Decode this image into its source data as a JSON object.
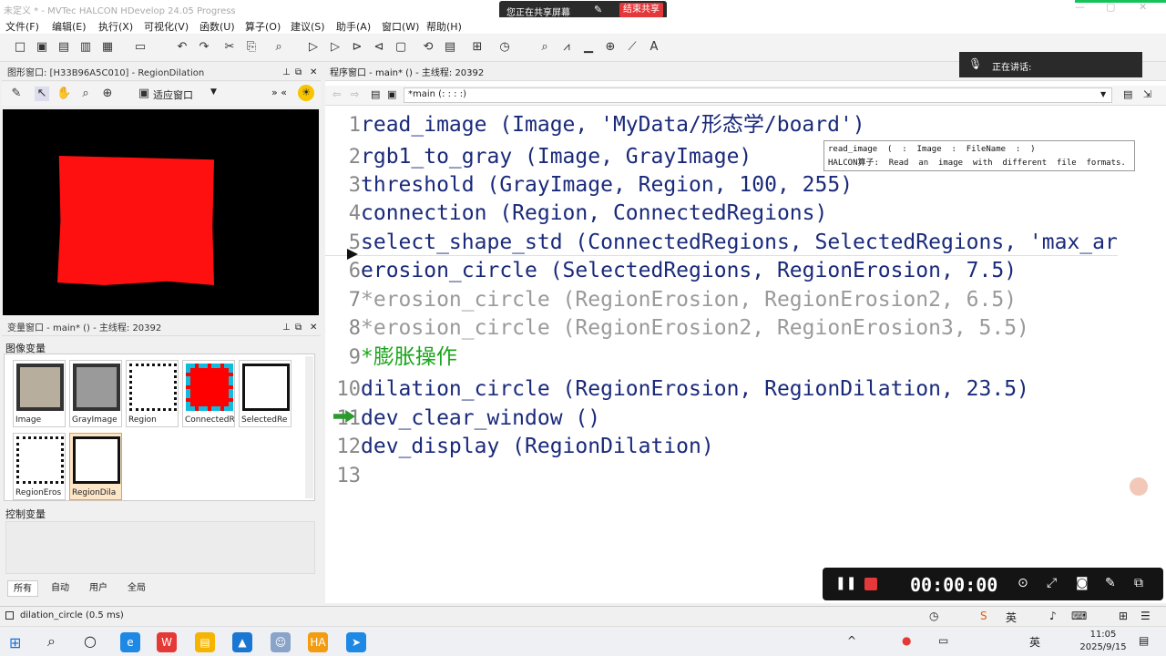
{
  "window": {
    "title": "未定义 * - MVTec HALCON HDevelop 24.05 Progress"
  },
  "share": {
    "status": "您正在共享屏幕",
    "end_label": "结束共享"
  },
  "menu": [
    "文件(F)",
    "编辑(E)",
    "执行(X)",
    "可视化(V)",
    "函数(U)",
    "算子(O)",
    "建议(S)",
    "助手(A)",
    "窗口(W)",
    "帮助(H)"
  ],
  "graphics": {
    "title": "图形窗口: [H33B96A5C010] - RegionDilation",
    "fit_label": "适应窗口",
    "region_color": "#ff1010"
  },
  "variables": {
    "title": "变量窗口 - main* () - 主线程: 20392",
    "image_section": "图像变量",
    "control_section": "控制变量",
    "thumbs": [
      "Image",
      "GrayImage",
      "Region",
      "ConnectedR",
      "SelectedRe",
      "RegionEros",
      "RegionDila"
    ],
    "tabs": [
      "所有",
      "自动",
      "用户",
      "全局"
    ]
  },
  "program": {
    "title": "程序窗口 - main* () - 主线程: 20392",
    "procedure": "*main (: : : :)",
    "lines": [
      {
        "n": "1",
        "text": "read_image (Image, 'MyData/形态学/board')",
        "style": "ok"
      },
      {
        "n": "2",
        "text": "rgb1_to_gray (Image, GrayImage)",
        "style": "ok"
      },
      {
        "n": "3",
        "text": "threshold (GrayImage, Region, 100, 255)",
        "style": "ok"
      },
      {
        "n": "4",
        "text": "connection (Region, ConnectedRegions)",
        "style": "ok"
      },
      {
        "n": "5",
        "text": "select_shape_std (ConnectedRegions, SelectedRegions, 'max_ar",
        "style": "ok"
      },
      {
        "n": "6",
        "text": "erosion_circle (SelectedRegions, RegionErosion, 7.5)",
        "style": "ok"
      },
      {
        "n": "7",
        "text": "*erosion_circle (RegionErosion, RegionErosion2, 6.5)",
        "style": "cm"
      },
      {
        "n": "8",
        "text": "*erosion_circle (RegionErosion2, RegionErosion3, 5.5)",
        "style": "cm"
      },
      {
        "n": "9",
        "text": "*膨胀操作",
        "style": "gr"
      },
      {
        "n": "10",
        "text": "dilation_circle (RegionErosion, RegionDilation, 23.5)",
        "style": "ok"
      },
      {
        "n": "11",
        "text": "dev_clear_window ()",
        "style": "ok"
      },
      {
        "n": "12",
        "text": "dev_display (RegionDilation)",
        "style": "ok"
      },
      {
        "n": "13",
        "text": "",
        "style": "ok"
      }
    ],
    "tooltip_line1": "read_image  (  :  Image  :  FileName  :  )",
    "tooltip_line2": "HALCON算子:  Read  an  image  with  different  file  formats."
  },
  "meeting": {
    "speaking_label": "正在讲话:",
    "timer": "00:00:00"
  },
  "status": {
    "text": "dilation_circle (0.5 ms)"
  },
  "taskbar": {
    "lang": "英",
    "time": "11:05",
    "date": "2025/9/15"
  }
}
